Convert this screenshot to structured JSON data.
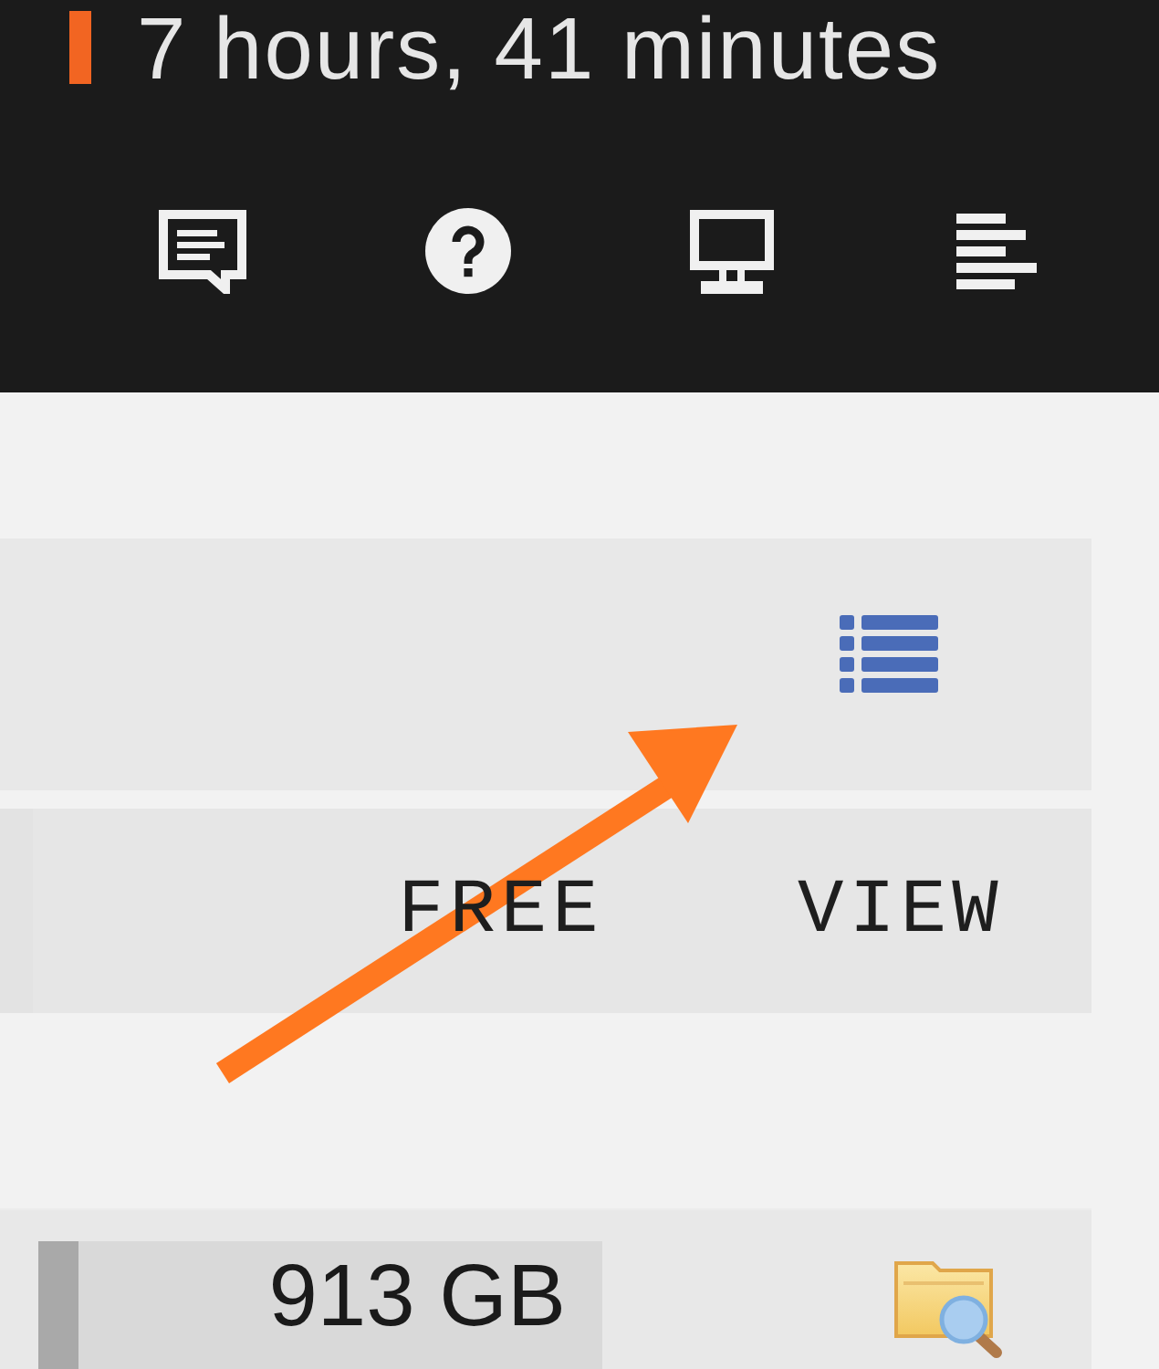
{
  "header": {
    "time_remaining": "7 hours, 41 minutes"
  },
  "table": {
    "columns": [
      {
        "label": "FREE"
      },
      {
        "label": "VIEW"
      }
    ],
    "rows": [
      {
        "free": {
          "text": "913 GB",
          "level": 0.07
        }
      }
    ]
  }
}
